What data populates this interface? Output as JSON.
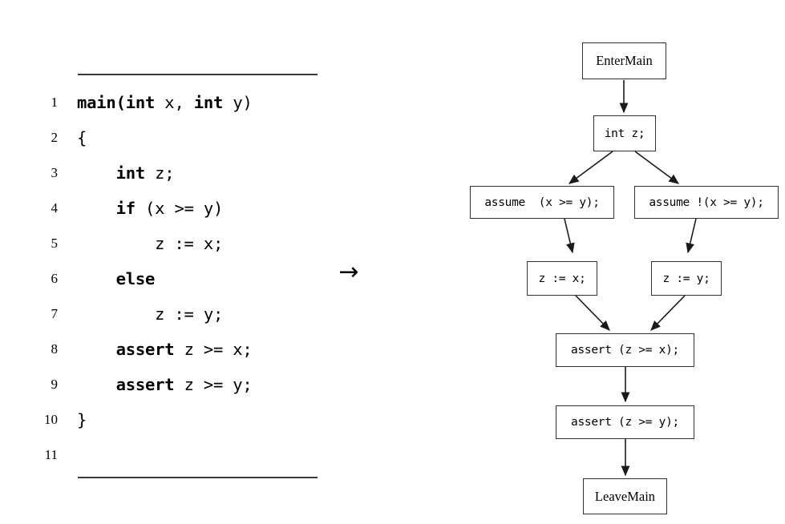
{
  "figure": {
    "transform_arrow": "→",
    "arrow_icon_name": "right-arrow-icon"
  },
  "code_listing": {
    "lines": [
      {
        "no": "1",
        "indent": 0,
        "segments": [
          {
            "t": "main(",
            "bold": false
          },
          {
            "t": "int",
            "bold": true
          },
          {
            "t": " x, ",
            "bold": false
          },
          {
            "t": "int",
            "bold": true
          },
          {
            "t": " y)",
            "bold": false
          }
        ],
        "plain": "main(int x, int y)"
      },
      {
        "no": "2",
        "indent": 0,
        "segments": [
          {
            "t": "{",
            "bold": false
          }
        ],
        "plain": "{"
      },
      {
        "no": "3",
        "indent": 4,
        "segments": [
          {
            "t": "int",
            "bold": true
          },
          {
            "t": " z;",
            "bold": false
          }
        ],
        "plain": "    int z;"
      },
      {
        "no": "4",
        "indent": 4,
        "segments": [
          {
            "t": "if",
            "bold": true
          },
          {
            "t": " (x >= y)",
            "bold": false
          }
        ],
        "plain": "    if (x >= y)"
      },
      {
        "no": "5",
        "indent": 8,
        "segments": [
          {
            "t": "z := x;",
            "bold": false
          }
        ],
        "plain": "        z := x;"
      },
      {
        "no": "6",
        "indent": 4,
        "segments": [
          {
            "t": "else",
            "bold": true
          }
        ],
        "plain": "    else"
      },
      {
        "no": "7",
        "indent": 8,
        "segments": [
          {
            "t": "z := y;",
            "bold": false
          }
        ],
        "plain": "        z := y;"
      },
      {
        "no": "8",
        "indent": 4,
        "segments": [
          {
            "t": "assert",
            "bold": true
          },
          {
            "t": " z >= x;",
            "bold": false
          }
        ],
        "plain": "    assert z >= x;"
      },
      {
        "no": "9",
        "indent": 4,
        "segments": [
          {
            "t": "assert",
            "bold": true
          },
          {
            "t": " z >= y;",
            "bold": false
          }
        ],
        "plain": "    assert z >= y;"
      },
      {
        "no": "10",
        "indent": 0,
        "segments": [
          {
            "t": "}",
            "bold": false
          }
        ],
        "plain": "}"
      },
      {
        "no": "11",
        "indent": 0,
        "segments": [
          {
            "t": "",
            "bold": false
          }
        ],
        "plain": ""
      }
    ]
  },
  "cfg": {
    "nodes": [
      {
        "id": "enter-main",
        "label": "EnterMain",
        "style": "serif"
      },
      {
        "id": "decl-z",
        "label": "int z;",
        "style": "mono"
      },
      {
        "id": "assume-then",
        "label": "assume  (x >= y);",
        "style": "mono"
      },
      {
        "id": "assume-else",
        "label": "assume !(x >= y);",
        "style": "mono"
      },
      {
        "id": "assign-z-x",
        "label": "z := x;",
        "style": "mono"
      },
      {
        "id": "assign-z-y",
        "label": "z := y;",
        "style": "mono"
      },
      {
        "id": "assert-z-ge-x",
        "label": "assert (z >= x);",
        "style": "mono"
      },
      {
        "id": "assert-z-ge-y",
        "label": "assert (z >= y);",
        "style": "mono"
      },
      {
        "id": "leave-main",
        "label": "LeaveMain",
        "style": "serif"
      }
    ],
    "edges": [
      {
        "from": "enter-main",
        "to": "decl-z"
      },
      {
        "from": "decl-z",
        "to": "assume-then"
      },
      {
        "from": "decl-z",
        "to": "assume-else"
      },
      {
        "from": "assume-then",
        "to": "assign-z-x"
      },
      {
        "from": "assume-else",
        "to": "assign-z-y"
      },
      {
        "from": "assign-z-x",
        "to": "assert-z-ge-x"
      },
      {
        "from": "assign-z-y",
        "to": "assert-z-ge-x"
      },
      {
        "from": "assert-z-ge-x",
        "to": "assert-z-ge-y"
      },
      {
        "from": "assert-z-ge-y",
        "to": "leave-main"
      }
    ],
    "colors": {
      "node_border": "#2f2f2f",
      "edge": "#1a1a1a",
      "background": "#ffffff"
    }
  }
}
